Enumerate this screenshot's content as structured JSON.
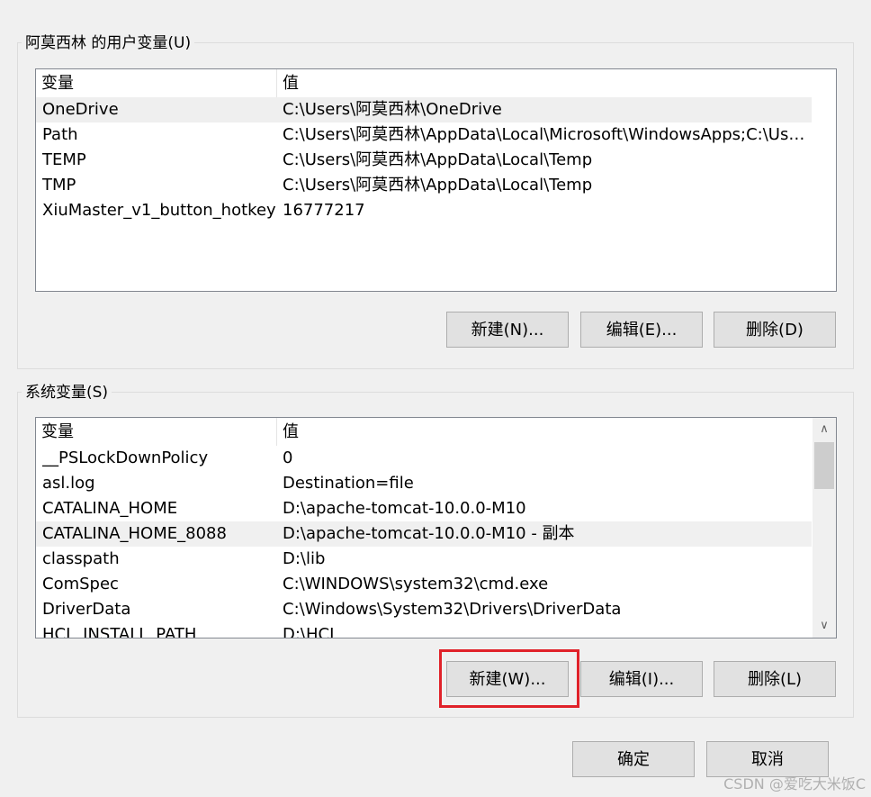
{
  "user_vars": {
    "label": "阿莫西林 的用户变量(U)",
    "columns": [
      "变量",
      "值"
    ],
    "rows": [
      {
        "name": "OneDrive",
        "value": "C:\\Users\\阿莫西林\\OneDrive"
      },
      {
        "name": "Path",
        "value": "C:\\Users\\阿莫西林\\AppData\\Local\\Microsoft\\WindowsApps;C:\\User..."
      },
      {
        "name": "TEMP",
        "value": "C:\\Users\\阿莫西林\\AppData\\Local\\Temp"
      },
      {
        "name": "TMP",
        "value": "C:\\Users\\阿莫西林\\AppData\\Local\\Temp"
      },
      {
        "name": "XiuMaster_v1_button_hotkey",
        "value": "16777217"
      }
    ],
    "buttons": {
      "new": "新建(N)...",
      "edit": "编辑(E)...",
      "delete": "删除(D)"
    }
  },
  "system_vars": {
    "label": "系统变量(S)",
    "columns": [
      "变量",
      "值"
    ],
    "rows": [
      {
        "name": "__PSLockDownPolicy",
        "value": "0"
      },
      {
        "name": "asl.log",
        "value": "Destination=file"
      },
      {
        "name": "CATALINA_HOME",
        "value": "D:\\apache-tomcat-10.0.0-M10"
      },
      {
        "name": "CATALINA_HOME_8088",
        "value": "D:\\apache-tomcat-10.0.0-M10 - 副本"
      },
      {
        "name": "classpath",
        "value": "D:\\lib"
      },
      {
        "name": "ComSpec",
        "value": "C:\\WINDOWS\\system32\\cmd.exe"
      },
      {
        "name": "DriverData",
        "value": "C:\\Windows\\System32\\Drivers\\DriverData"
      },
      {
        "name": "HCL_INSTALL_PATH",
        "value": "D:\\HCL"
      }
    ],
    "buttons": {
      "new": "新建(W)...",
      "edit": "编辑(I)...",
      "delete": "删除(L)"
    }
  },
  "dialog": {
    "ok": "确定",
    "cancel": "取消"
  },
  "watermark": "CSDN @爱吃大米饭C",
  "colors": {
    "highlight": "#e0222a",
    "button_bg": "#e1e1e1",
    "window_bg": "#f0f0f0"
  }
}
